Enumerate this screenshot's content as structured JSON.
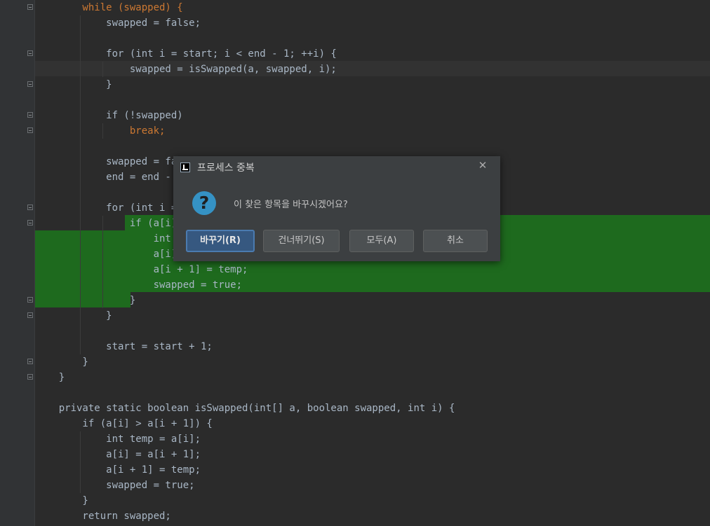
{
  "code_lines": [
    "        while (swapped) {",
    "            swapped = false;",
    "",
    "            for (int i = start; i < end - 1; ++i) {",
    "                swapped = isSwapped(a, swapped, i);",
    "            }",
    "",
    "            if (!swapped)",
    "                break;",
    "",
    "            swapped = fal",
    "            end = end - 1",
    "",
    "            for (int i = ",
    "                if (a[i] ",
    "                    int t",
    "                    a[i] ",
    "                    a[i + 1] = temp;",
    "                    swapped = true;",
    "                }",
    "            }",
    "",
    "            start = start + 1;",
    "        }",
    "    }",
    "",
    "    private static boolean isSwapped(int[] a, boolean swapped, int i) {",
    "        if (a[i] > a[i + 1]) {",
    "            int temp = a[i];",
    "            a[i] = a[i + 1];",
    "            a[i + 1] = temp;",
    "            swapped = true;",
    "        }",
    "        return swapped;"
  ],
  "colors": {
    "editor_background": "#2b2b2b",
    "keyword": "#cc7832",
    "number": "#6897bb",
    "identifier": "#a9b7c6",
    "replace_highlight": "#1e6a1e",
    "dialog_background": "#3c3f41",
    "accent_button": "#365880",
    "question_icon": "#3592c4"
  },
  "dialog": {
    "title": "프로세스 중복",
    "logo_icon": "intellij-logo-icon",
    "close_icon": "close-icon",
    "close_glyph": "✕",
    "question_icon": "question-icon",
    "question_glyph": "?",
    "message": "이 찾은 항목을 바꾸시겠어요?",
    "buttons": {
      "replace": "바꾸기(R)",
      "skip": "건너뛰기(S)",
      "all": "모두(A)",
      "cancel": "취소"
    }
  }
}
